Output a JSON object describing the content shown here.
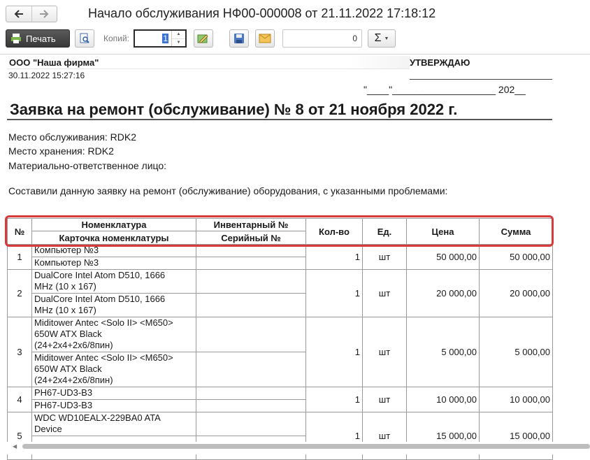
{
  "window": {
    "title": "Начало обслуживания НФ00-000008 от 21.11.2022 17:18:12"
  },
  "toolbar": {
    "print_label": "Печать",
    "copies_label": "Копий:",
    "copies_value": "1",
    "sum_value": "0",
    "sigma_label": "Σ"
  },
  "document": {
    "company": "ООО \"Наша фирма\"",
    "date": "30.11.2022 15:27:16",
    "approve": "УТВЕРЖДАЮ",
    "approve_sign": "\"____\"___________________  202__",
    "heading": "Заявка на ремонт (обслуживание) № 8 от 21 ноября 2022 г.",
    "service_place": "Место обслуживания: RDK2",
    "storage_place": "Место хранения: RDK2",
    "responsible": "Материально-ответственное лицо:",
    "intro": "Составили данную заявку на ремонт (обслуживание) оборудования, с указанными проблемами:"
  },
  "table": {
    "headers": {
      "num": "№",
      "nomenclature": "Номенклатура",
      "card": "Карточка номенклатуры",
      "inventory": "Инвентарный №",
      "serial": "Серийный №",
      "qty": "Кол-во",
      "unit": "Ед.",
      "price": "Цена",
      "sum": "Сумма"
    },
    "rows": [
      {
        "num": "1",
        "nomenclature": [
          "Компьютер №3"
        ],
        "card": [
          "Компьютер №3"
        ],
        "qty": "1",
        "unit": "шт",
        "price": "50 000,00",
        "sum": "50 000,00"
      },
      {
        "num": "2",
        "nomenclature": [
          "DualCore Intel Atom D510, 1666",
          "MHz (10 x 167)"
        ],
        "card": [
          "DualCore Intel Atom D510, 1666",
          "MHz (10 x 167)"
        ],
        "qty": "1",
        "unit": "шт",
        "price": "20 000,00",
        "sum": "20 000,00"
      },
      {
        "num": "3",
        "nomenclature": [
          "Miditower Antec <Solo II> <M650>",
          "650W ATX Black",
          "(24+2x4+2x6/8пин)"
        ],
        "card": [
          "Miditower Antec <Solo II> <M650>",
          "650W ATX Black",
          "(24+2x4+2x6/8пин)"
        ],
        "qty": "1",
        "unit": "шт",
        "price": "5 000,00",
        "sum": "5 000,00"
      },
      {
        "num": "4",
        "nomenclature": [
          "PH67-UD3-B3"
        ],
        "card": [
          "PH67-UD3-B3"
        ],
        "qty": "1",
        "unit": "шт",
        "price": "10 000,00",
        "sum": "10 000,00"
      },
      {
        "num": "5",
        "nomenclature": [
          "WDC WD10EALX-229BA0 ATA",
          "Device"
        ],
        "card": [],
        "qty": "1",
        "unit": "шт",
        "price": "15 000,00",
        "sum": "15 000,00"
      }
    ]
  },
  "colors": {
    "highlight": "#d63a3a",
    "print_button": "#3a3a3a"
  }
}
